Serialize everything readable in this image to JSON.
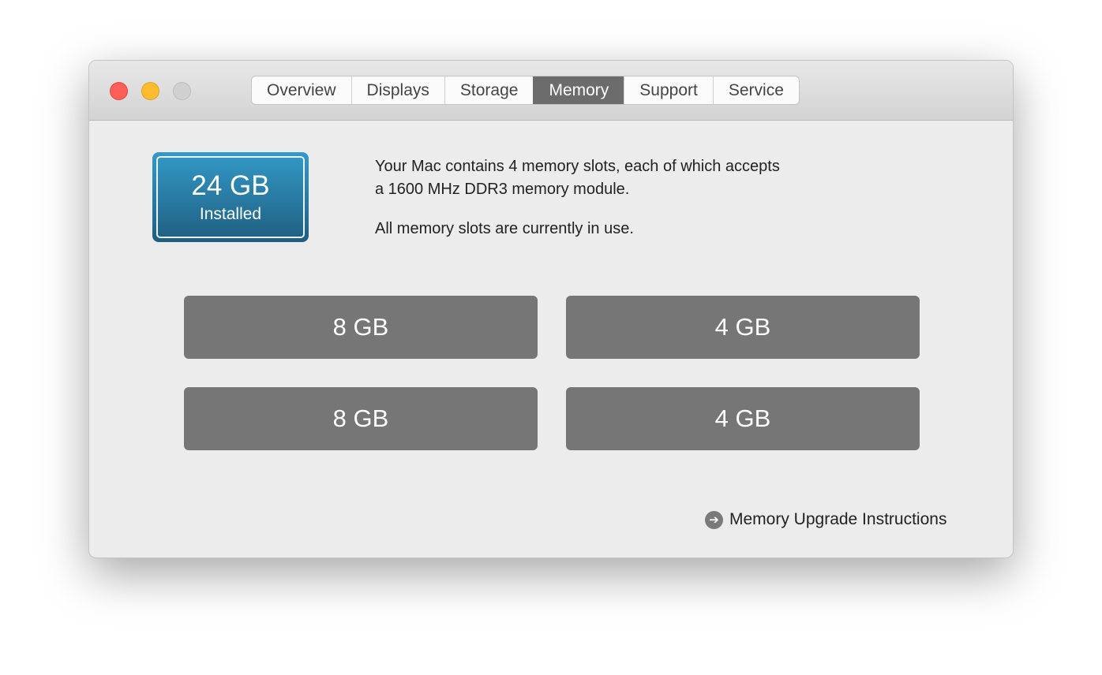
{
  "window": {
    "controls": {
      "close": "#fe5f57",
      "minimize": "#febc2e",
      "zoom": "#d0d0d0"
    }
  },
  "tabs": [
    {
      "label": "Overview"
    },
    {
      "label": "Displays"
    },
    {
      "label": "Storage"
    },
    {
      "label": "Memory",
      "active": true
    },
    {
      "label": "Support"
    },
    {
      "label": "Service"
    }
  ],
  "memory": {
    "installed_amount": "24 GB",
    "installed_label": "Installed",
    "description_line1": "Your Mac contains 4 memory slots, each of which accepts",
    "description_line2": "a 1600 MHz DDR3 memory module.",
    "status": "All memory slots are currently in use.",
    "slots": [
      {
        "size": "8 GB"
      },
      {
        "size": "4 GB"
      },
      {
        "size": "8 GB"
      },
      {
        "size": "4 GB"
      }
    ],
    "upgrade_link": "Memory Upgrade Instructions",
    "upgrade_icon": "arrow-right-circle-icon"
  }
}
